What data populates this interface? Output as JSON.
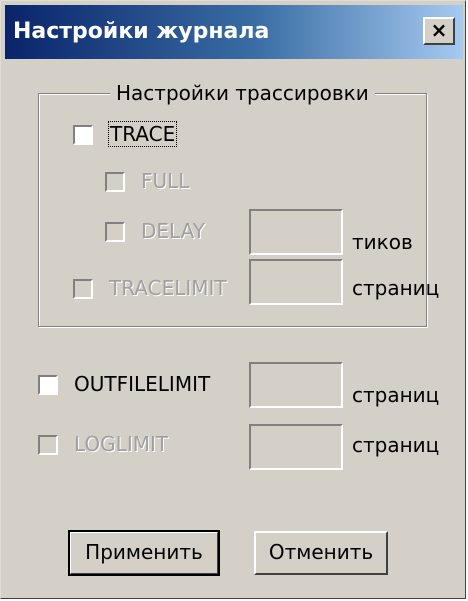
{
  "window": {
    "title": "Настройки журнала",
    "close_glyph": "×",
    "close_icon": "close-icon"
  },
  "trace_group": {
    "legend": "Настройки трассировки",
    "trace": {
      "label": "TRACE",
      "checked": false,
      "enabled": true
    },
    "full": {
      "label": "FULL",
      "checked": false,
      "enabled": false
    },
    "delay": {
      "label": "DELAY",
      "checked": false,
      "enabled": false,
      "value": "",
      "unit": "тиков"
    },
    "tracelimit": {
      "label": "TRACELIMIT",
      "checked": false,
      "enabled": false,
      "value": "",
      "unit": "страниц"
    }
  },
  "outfilelimit": {
    "label": "OUTFILELIMIT",
    "checked": false,
    "enabled": true,
    "value": "",
    "unit": "страниц"
  },
  "loglimit": {
    "label": "LOGLIMIT",
    "checked": false,
    "enabled": false,
    "value": "",
    "unit": "страниц"
  },
  "buttons": {
    "apply_label": "Применить",
    "cancel_label": "Отменить"
  },
  "colors": {
    "dialog_bg": "#d4d0c8",
    "title_start": "#0a246a",
    "title_end": "#a6caf0",
    "disabled_text": "#a0a0a0"
  }
}
